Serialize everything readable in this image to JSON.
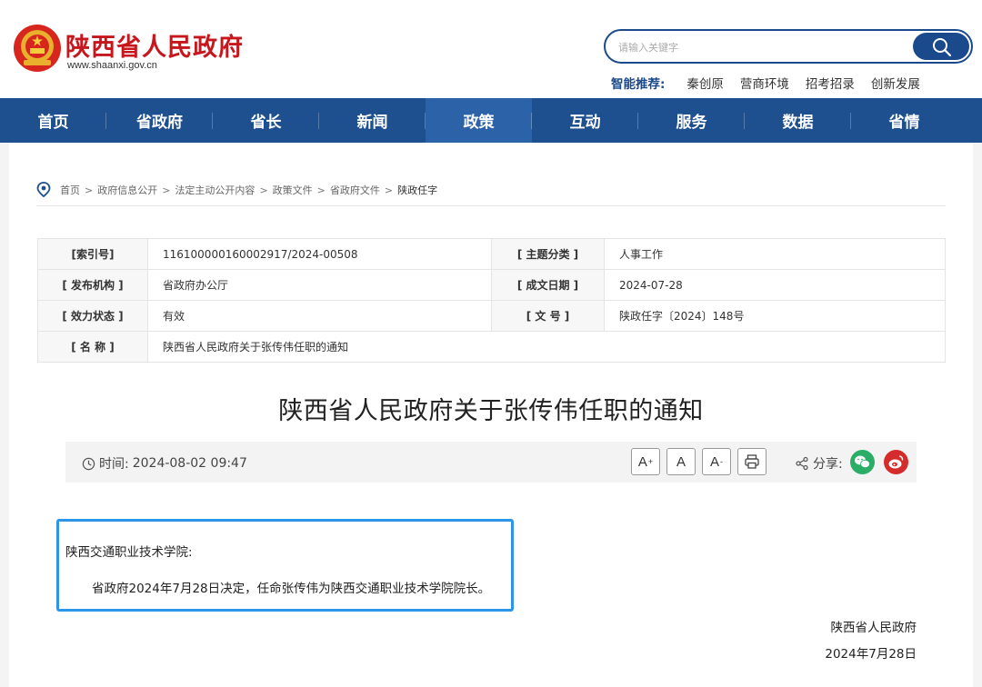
{
  "header": {
    "site_title": "陕西省人民政府",
    "site_url": "www.shaanxi.gov.cn",
    "search_placeholder": "请输入关键字",
    "recommend_label": "智能推荐:",
    "recommend_items": [
      "秦创原",
      "营商环境",
      "招考招录",
      "创新发展"
    ]
  },
  "nav": {
    "items": [
      "首页",
      "省政府",
      "省长",
      "新闻",
      "政策",
      "互动",
      "服务",
      "数据",
      "省情"
    ],
    "active": "政策"
  },
  "breadcrumb": {
    "items": [
      "首页",
      "政府信息公开",
      "法定主动公开内容",
      "政策文件",
      "省政府文件",
      "陕政任字"
    ],
    "separator": ">"
  },
  "info": {
    "index_label": "[索引号]",
    "index_value": "116100000160002917/2024-00508",
    "topic_label": "[ 主题分类 ]",
    "topic_value": "人事工作",
    "issuer_label": "[ 发布机构 ]",
    "issuer_value": "省政府办公厅",
    "date_label": "[ 成文日期 ]",
    "date_value": "2024-07-28",
    "status_label": "[ 效力状态 ]",
    "status_value": "有效",
    "docno_label": "[ 文 号 ]",
    "docno_value": "陕政任字〔2024〕148号",
    "name_label": "[ 名 称 ]",
    "name_value": "陕西省人民政府关于张传伟任职的通知"
  },
  "article": {
    "title": "陕西省人民政府关于张传伟任职的通知",
    "time_label": "时间:",
    "time_value": "2024-08-02 09:47",
    "font_large": "A",
    "font_medium": "A",
    "font_small": "A",
    "share_label": "分享:",
    "addressee": "陕西交通职业技术学院:",
    "body": "省政府2024年7月28日决定，任命张传伟为陕西交通职业技术学院院长。",
    "sign_org": "陕西省人民政府",
    "sign_date": "2024年7月28日"
  },
  "colors": {
    "brand_red": "#c8161d",
    "nav_blue": "#1e4f8f",
    "highlight_blue": "#2b96e8",
    "wechat_green": "#2aae67",
    "weibo_red": "#d52b2b"
  }
}
